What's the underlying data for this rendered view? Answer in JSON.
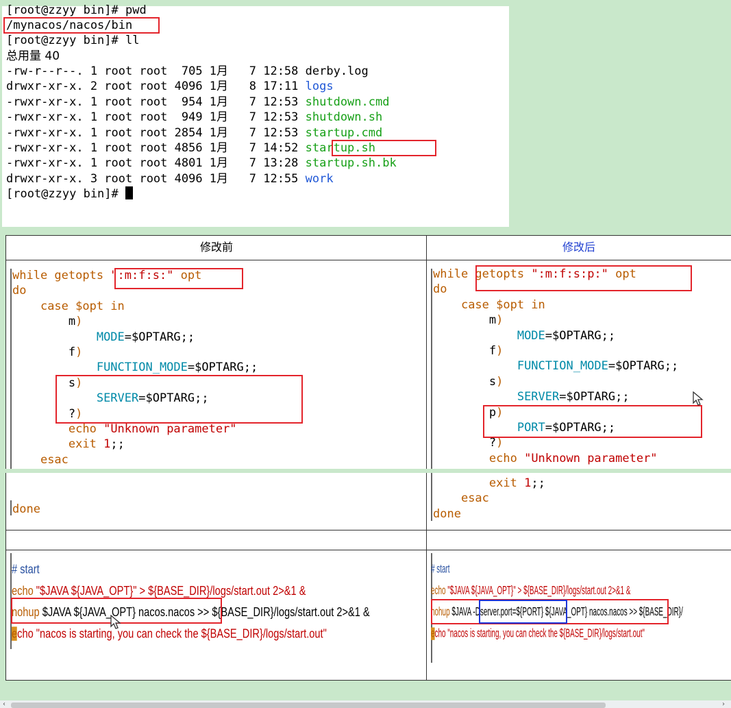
{
  "terminal": {
    "lines": [
      "[root@zzyy bin]# pwd",
      "/mynacos/nacos/bin",
      "[root@zzyy bin]# ll",
      "总用量 40"
    ],
    "files": [
      {
        "perm": "-rw-r--r--.",
        "links": "1",
        "owner": "root",
        "group": "root",
        "size": "705",
        "month": "1月",
        "day": "7",
        "time": "12:58",
        "name": "derby.log",
        "kind": "plain"
      },
      {
        "perm": "drwxr-xr-x.",
        "links": "2",
        "owner": "root",
        "group": "root",
        "size": "4096",
        "month": "1月",
        "day": "8",
        "time": "17:11",
        "name": "logs",
        "kind": "dir"
      },
      {
        "perm": "-rwxr-xr-x.",
        "links": "1",
        "owner": "root",
        "group": "root",
        "size": "954",
        "month": "1月",
        "day": "7",
        "time": "12:53",
        "name": "shutdown.cmd",
        "kind": "exec"
      },
      {
        "perm": "-rwxr-xr-x.",
        "links": "1",
        "owner": "root",
        "group": "root",
        "size": "949",
        "month": "1月",
        "day": "7",
        "time": "12:53",
        "name": "shutdown.sh",
        "kind": "exec"
      },
      {
        "perm": "-rwxr-xr-x.",
        "links": "1",
        "owner": "root",
        "group": "root",
        "size": "2854",
        "month": "1月",
        "day": "7",
        "time": "12:53",
        "name": "startup.cmd",
        "kind": "exec"
      },
      {
        "perm": "-rwxr-xr-x.",
        "links": "1",
        "owner": "root",
        "group": "root",
        "size": "4856",
        "month": "1月",
        "day": "7",
        "time": "14:52",
        "name": "startup.sh",
        "kind": "exec"
      },
      {
        "perm": "-rwxr-xr-x.",
        "links": "1",
        "owner": "root",
        "group": "root",
        "size": "4801",
        "month": "1月",
        "day": "7",
        "time": "13:28",
        "name": "startup.sh.bk",
        "kind": "exec"
      },
      {
        "perm": "drwxr-xr-x.",
        "links": "3",
        "owner": "root",
        "group": "root",
        "size": "4096",
        "month": "1月",
        "day": "7",
        "time": "12:55",
        "name": "work",
        "kind": "dir"
      }
    ],
    "prompt": "[root@zzyy bin]# "
  },
  "table": {
    "header_before": "修改前",
    "header_after": "修改后",
    "before_code": {
      "l1_kw": "while getopts ",
      "l1_str": "\":m:f:s:\"",
      "l1_opt": " opt",
      "do": "do",
      "case": "case $opt in",
      "m": "m",
      "mode_var": "MODE",
      "mode_rest": "=$OPTARG;;",
      "f": "f",
      "func_var": "FUNCTION_MODE",
      "func_rest": "=$OPTARG;;",
      "s": "s",
      "server_var": "SERVER",
      "server_rest": "=$OPTARG;;",
      "q": "?",
      "echo": "echo ",
      "echo_str": "\"Unknown parameter\"",
      "exit": "exit ",
      "exit_num": "1",
      "exit_rest": ";;",
      "esac": "esac",
      "done": "done"
    },
    "after_code": {
      "l1_kw": "while ",
      "l1_kw2": "getopts ",
      "l1_str": "\":m:f:s:p:\"",
      "l1_opt": " opt",
      "do": "do",
      "case": "case $opt in",
      "m": "m",
      "mode_var": "MODE",
      "mode_rest": "=$OPTARG;;",
      "f": "f",
      "func_var": "FUNCTION_MODE",
      "func_rest": "=$OPTARG;;",
      "s": "s",
      "server_var": "SERVER",
      "server_rest": "=$OPTARG;;",
      "p": "p",
      "port_var": "PORT",
      "port_rest": "=$OPTARG;;",
      "q": "?",
      "echo": "echo ",
      "echo_str": "\"Unknown parameter\"",
      "exit": "exit ",
      "exit_num": "1",
      "exit_rest": ";;",
      "esac": "esac",
      "done": "done"
    },
    "before_start": {
      "comment": "# start",
      "l2_a": "echo ",
      "l2_b": "\"$JAVA ${JAVA_OPT}\" > ${BASE_DIR}/logs/start.out 2>&1 &",
      "l3_a": "nohup ",
      "l3_b": "$JAVA ${JAVA_OPT} nacos.nacos >> ${BASE_DIR}/logs/start.out 2>&1 &",
      "l4_a": "e",
      "l4_b": "cho \"nacos is starting, you can check the ${BASE_DIR}/logs/start.out\""
    },
    "after_start": {
      "comment": "# start",
      "l2_a": "echo ",
      "l2_b": "\"$JAVA ${JAVA_OPT}\" > ${BASE_DIR}/logs/start.out 2>&1 &",
      "l3_a": "nohup ",
      "l3_b": "$JAVA ",
      "l3_c": "-Dserver.port=${PORT}",
      "l3_d": " ${JAVA_OPT} nacos.nacos >> ${BASE_DIR}/",
      "l4_a": "e",
      "l4_b": "cho \"nacos is starting, you can check the ${BASE_DIR}/logs/start.out\""
    }
  },
  "colors": {
    "keyword": "#b85c00",
    "variable": "#008aa8",
    "string": "#c00000",
    "highlight_box": "#e3242b",
    "port_box": "#1d35d8"
  }
}
